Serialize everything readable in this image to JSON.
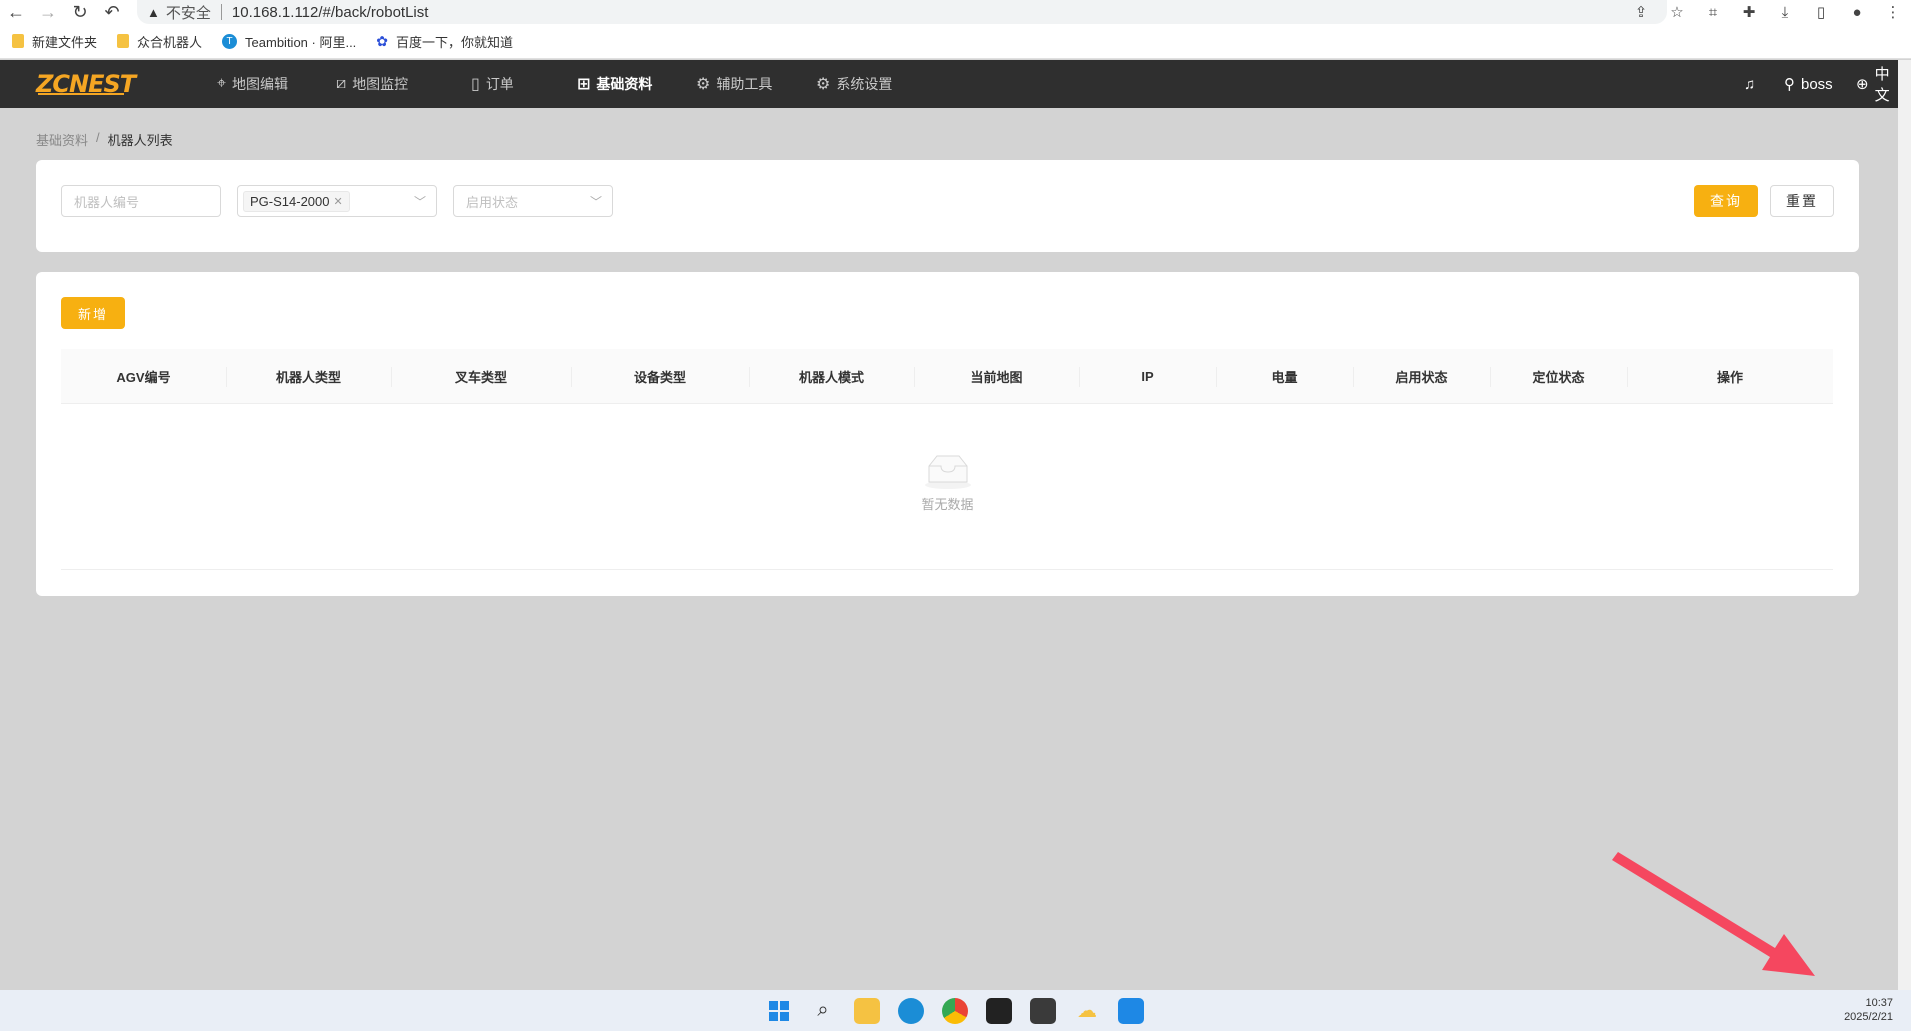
{
  "browser": {
    "url": "10.168.1.112/#/back/robotList",
    "insecure_label": "不安全",
    "bookmarks": [
      {
        "label": "新建文件夹"
      },
      {
        "label": "众合机器人"
      },
      {
        "label": "Teambition · 阿里..."
      },
      {
        "label": "百度一下，你就知道"
      }
    ]
  },
  "header": {
    "logo": "ZCNEST",
    "nav": [
      {
        "label": "地图编辑",
        "icon": "map-pin-icon"
      },
      {
        "label": "地图监控",
        "icon": "chart-icon"
      },
      {
        "label": "订单",
        "icon": "document-icon"
      },
      {
        "label": "基础资料",
        "icon": "sliders-icon",
        "active": true
      },
      {
        "label": "辅助工具",
        "icon": "gear-icon"
      },
      {
        "label": "系统设置",
        "icon": "gear-icon"
      }
    ],
    "user": "boss",
    "language": "中文"
  },
  "breadcrumb": {
    "root": "基础资料",
    "separator": "/",
    "current": "机器人列表"
  },
  "filters": {
    "robot_no_placeholder": "机器人编号",
    "robot_type_tag": "PG-S14-2000",
    "status_placeholder": "启用状态",
    "query_label": "查询",
    "reset_label": "重置"
  },
  "list": {
    "add_label": "新增",
    "columns": [
      "AGV编号",
      "机器人类型",
      "叉车类型",
      "设备类型",
      "机器人模式",
      "当前地图",
      "IP",
      "电量",
      "启用状态",
      "定位状态",
      "操作"
    ],
    "empty_text": "暂无数据"
  },
  "taskbar": {
    "time": "10:37",
    "date": "2025/2/21"
  },
  "colors": {
    "accent": "#f7b011",
    "header_bg": "#2f2f2f",
    "annotation": "#f5475f"
  }
}
